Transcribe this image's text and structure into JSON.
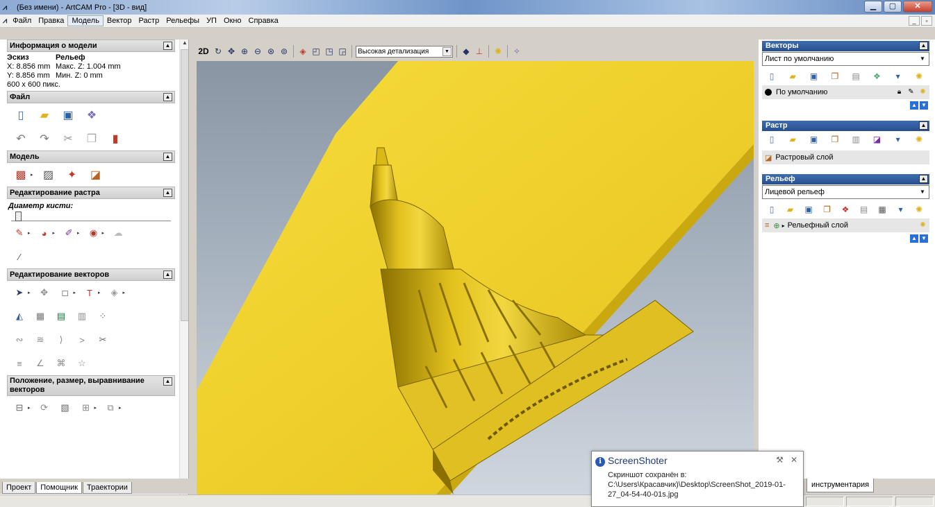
{
  "window": {
    "title": "(Без имени) - ArtCAM Pro - [3D - вид]",
    "app_icon": "artcam-icon",
    "buttons": {
      "minimize": "▁",
      "maximize": "▢",
      "close": "✕"
    }
  },
  "menu": {
    "items": [
      "Файл",
      "Правка",
      "Модель",
      "Вектор",
      "Растр",
      "Рельефы",
      "УП",
      "Окно",
      "Справка"
    ],
    "active": "Модель"
  },
  "left_panel": {
    "model_info": {
      "title": "Информация о модели",
      "sketch_label": "Эскиз",
      "relief_label": "Рельеф",
      "x": "X: 8.856 mm",
      "max_z": "Макс. Z: 1.004 mm",
      "y": "Y: 8.856 mm",
      "min_z": "Мин. Z: 0 mm",
      "pixels": "600 x 600 пикс."
    },
    "sections": {
      "file": "Файл",
      "model": "Модель",
      "raster_edit": "Редактирование растра",
      "vector_edit": "Редактирование векторов",
      "position": "Положение, размер, выравнивание векторов"
    },
    "brush_label": "Диаметр кисти:",
    "tabs": [
      "Проект",
      "Помощник",
      "Траектории"
    ],
    "active_tab": "Помощник"
  },
  "viewport_toolbar": {
    "mode_2d": "2D",
    "detail_select": "Высокая детализация"
  },
  "right_panel": {
    "vectors": {
      "title": "Векторы",
      "sheet_select": "Лист по умолчанию",
      "layer": "По умолчанию"
    },
    "raster": {
      "title": "Растр",
      "layer": "Растровый слой"
    },
    "relief": {
      "title": "Рельеф",
      "select": "Лицевой рельеф",
      "layer": "Рельефный слой"
    },
    "bottom_tab": "инструментария"
  },
  "toast": {
    "title": "ScreenShoter",
    "line1": "Скриншот сохранён в:",
    "line2": "C:\\Users\\Красавчик)\\Desktop\\ScreenShot_2019-01-",
    "line3": "27_04-54-40-01s.jpg"
  },
  "colors": {
    "relief_gold": "#f3d42a",
    "panel_header_blue": "#2f5ea0",
    "viewport_bg": "#a7b2bf"
  }
}
